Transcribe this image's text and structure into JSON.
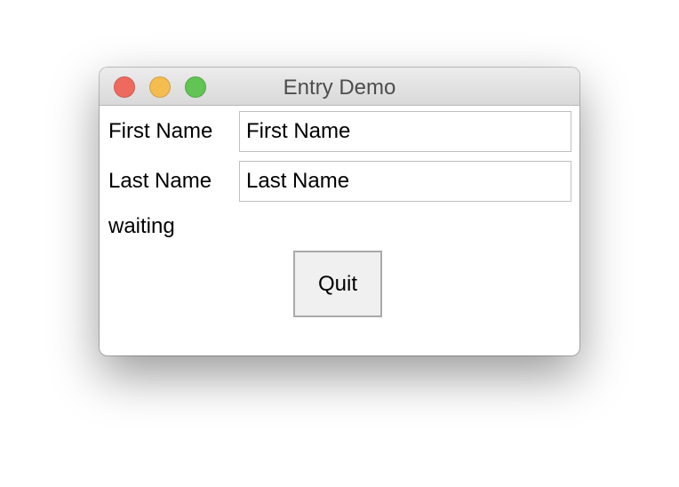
{
  "window": {
    "title": "Entry Demo",
    "controls": {
      "close_color": "#ee6a5f",
      "minimize_color": "#f5bd4f",
      "zoom_color": "#61c454"
    }
  },
  "form": {
    "first_name": {
      "label": "First Name",
      "value": "First Name"
    },
    "last_name": {
      "label": "Last Name",
      "value": "Last Name"
    },
    "status": "waiting",
    "quit_label": "Quit"
  }
}
